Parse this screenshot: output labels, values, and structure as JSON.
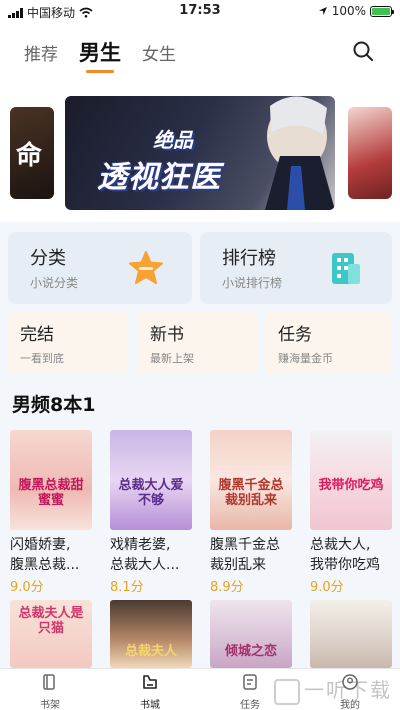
{
  "status_bar": {
    "carrier": "中国移动",
    "time": "17:53",
    "battery": "100%"
  },
  "top_tabs": [
    {
      "label": "推荐"
    },
    {
      "label": "男生"
    },
    {
      "label": "女生"
    }
  ],
  "banner": {
    "title": "透视狂医",
    "subtitle": "绝品",
    "left_card_text": "命"
  },
  "categories": [
    {
      "title": "分类",
      "subtitle": "小说分类"
    },
    {
      "title": "排行榜",
      "subtitle": "小说排行榜"
    }
  ],
  "shortcuts": [
    {
      "title": "完结",
      "subtitle": "一看到底"
    },
    {
      "title": "新书",
      "subtitle": "最新上架"
    },
    {
      "title": "任务",
      "subtitle": "赚海量金币"
    }
  ],
  "section": {
    "title": "男频8本1"
  },
  "books": [
    {
      "name_line1": "闪婚娇妻,",
      "name_line2": "腹黑总裁...",
      "score": "9.0分",
      "cover_text": "腹黑总裁甜蜜蜜"
    },
    {
      "name_line1": "戏精老婆,",
      "name_line2": "总裁大人...",
      "score": "8.1分",
      "cover_text": "总裁大人爱不够"
    },
    {
      "name_line1": "腹黑千金总",
      "name_line2": "裁别乱来",
      "score": "8.9分",
      "cover_text": "腹黑千金总裁别乱来"
    },
    {
      "name_line1": "总裁大人,",
      "name_line2": "我带你吃鸡",
      "score": "9.0分",
      "cover_text": "我带你吃鸡"
    }
  ],
  "books_row2": [
    {
      "cover_text": "总裁夫人是只猫"
    },
    {
      "cover_text": "总裁夫人"
    },
    {
      "cover_text": "倾城之恋"
    },
    {
      "cover_text": ""
    }
  ],
  "bottom_nav": [
    {
      "label": "书架",
      "icon": "bookshelf-icon"
    },
    {
      "label": "书城",
      "icon": "bookstore-icon"
    },
    {
      "label": "任务",
      "icon": "task-icon"
    },
    {
      "label": "我的",
      "icon": "profile-icon"
    }
  ],
  "watermark": "一听下载",
  "colors": {
    "accent": "#f18a2b",
    "score": "#e8a321",
    "star": "#f7a233",
    "rank": "#3cc7c9"
  }
}
